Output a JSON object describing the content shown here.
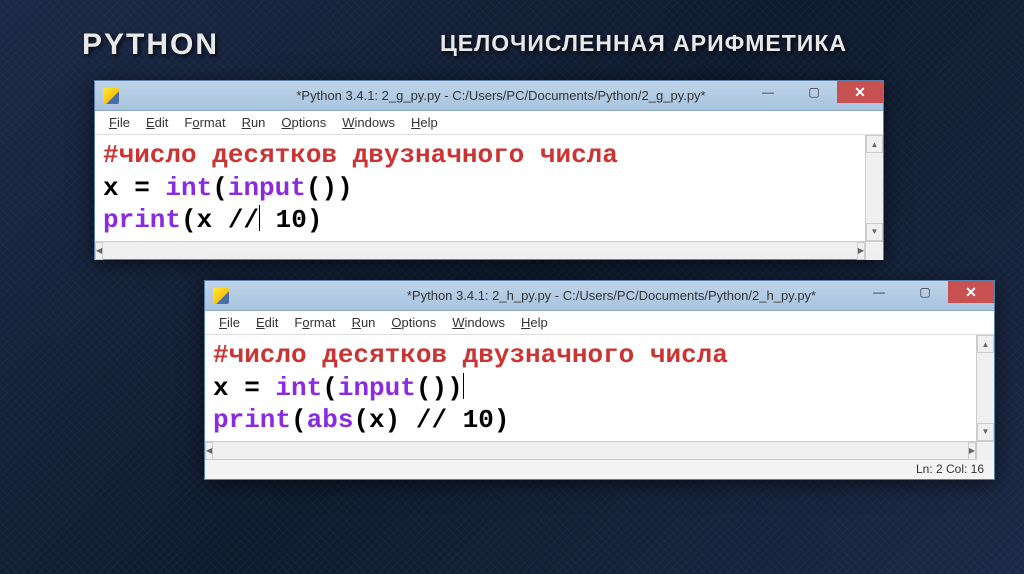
{
  "slide": {
    "title_left": "PYTHON",
    "title_right": "ЦЕЛОЧИСЛЕННАЯ АРИФМЕТИКА"
  },
  "menus": {
    "file": "File",
    "edit": "Edit",
    "format": "Format",
    "run": "Run",
    "options": "Options",
    "windows": "Windows",
    "help": "Help"
  },
  "window1": {
    "title": "*Python 3.4.1: 2_g_py.py - C:/Users/PC/Documents/Python/2_g_py.py*",
    "code": {
      "comment": "#число десятков двузначного числа",
      "line2_a": "x = ",
      "line2_b": "int",
      "line2_c": "(",
      "line2_d": "input",
      "line2_e": "())",
      "line3_a": "print",
      "line3_b": "(x //",
      "line3_c": " 10)"
    }
  },
  "window2": {
    "title": "*Python 3.4.1: 2_h_py.py - C:/Users/PC/Documents/Python/2_h_py.py*",
    "code": {
      "comment": "#число десятков двузначного числа",
      "line2_a": "x = ",
      "line2_b": "int",
      "line2_c": "(",
      "line2_d": "input",
      "line2_e": "())",
      "line3_a": "print",
      "line3_b": "(",
      "line3_c": "abs",
      "line3_d": "(x) // 10)"
    },
    "status": "Ln: 2 Col: 16"
  },
  "controls": {
    "minimize": "—",
    "maximize": "▢",
    "close": "✕"
  },
  "scroll": {
    "up": "▲",
    "down": "▼",
    "left": "◀",
    "right": "▶"
  }
}
